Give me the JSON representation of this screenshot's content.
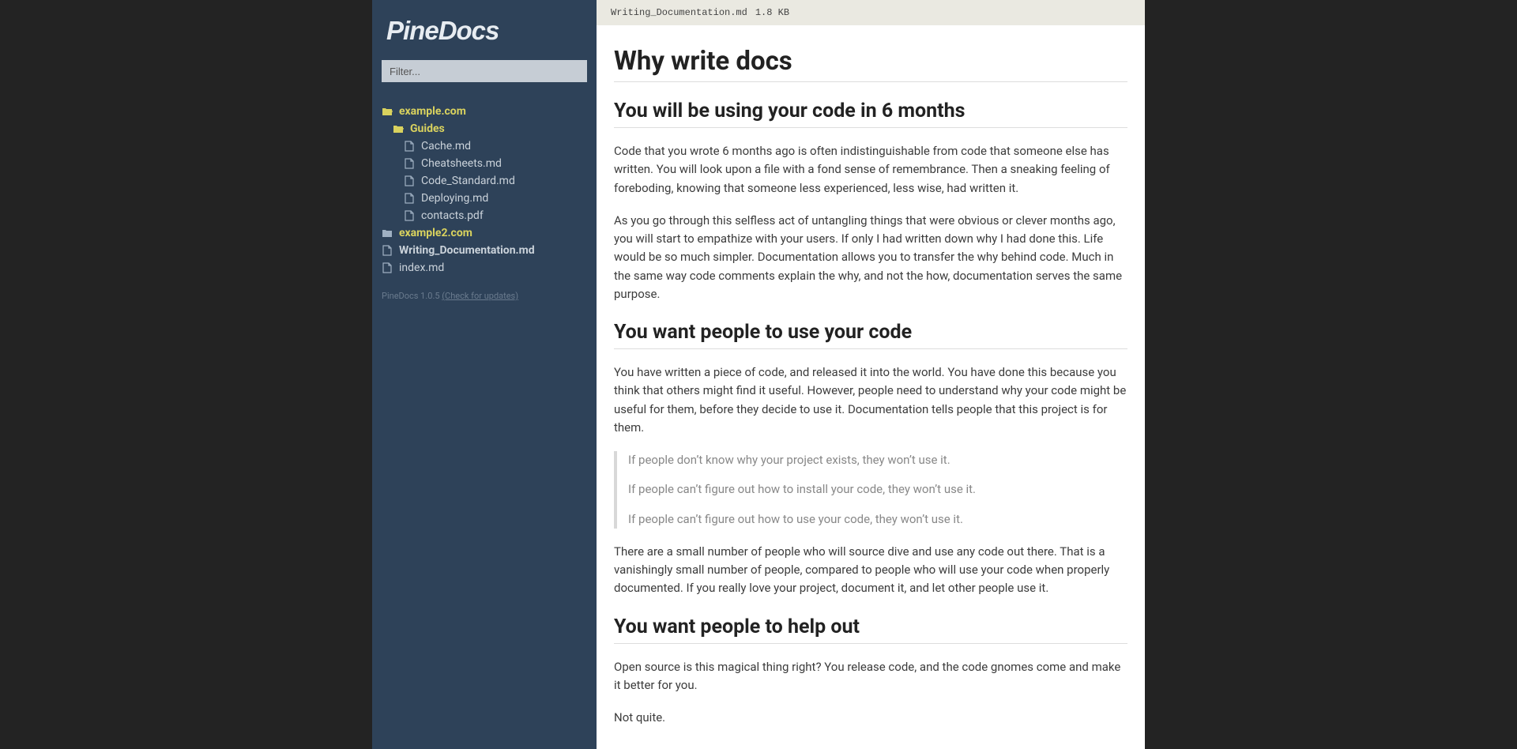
{
  "app": {
    "title": "PineDocs"
  },
  "search": {
    "placeholder": "Filter..."
  },
  "tree": [
    {
      "type": "folder-open",
      "label": "example.com",
      "indent": 1,
      "active": false
    },
    {
      "type": "folder-open",
      "label": "Guides",
      "indent": 2,
      "active": false
    },
    {
      "type": "file",
      "label": "Cache.md",
      "indent": 3,
      "active": false
    },
    {
      "type": "file",
      "label": "Cheatsheets.md",
      "indent": 3,
      "active": false
    },
    {
      "type": "file",
      "label": "Code_Standard.md",
      "indent": 3,
      "active": false
    },
    {
      "type": "file",
      "label": "Deploying.md",
      "indent": 3,
      "active": false
    },
    {
      "type": "file",
      "label": "contacts.pdf",
      "indent": 3,
      "active": false
    },
    {
      "type": "folder",
      "label": "example2.com",
      "indent": 1,
      "active": false
    },
    {
      "type": "file",
      "label": "Writing_Documentation.md",
      "indent": 1,
      "active": true
    },
    {
      "type": "file",
      "label": "index.md",
      "indent": 1,
      "active": false
    }
  ],
  "footer": {
    "version": "PineDocs 1.0.5 ",
    "link": "(Check for updates)"
  },
  "header": {
    "filename": "Writing_Documentation.md",
    "size": "1.8 KB"
  },
  "doc": {
    "h1": "Why write docs",
    "h2a": "You will be using your code in 6 months",
    "p1": "Code that you wrote 6 months ago is often indistinguishable from code that someone else has written. You will look upon a file with a fond sense of remembrance. Then a sneaking feeling of foreboding, knowing that someone less experienced, less wise, had written it.",
    "p2": "As you go through this selfless act of untangling things that were obvious or clever months ago, you will start to empathize with your users. If only I had written down why I had done this. Life would be so much simpler. Documentation allows you to transfer the why behind code. Much in the same way code comments explain the why, and not the how, documentation serves the same purpose.",
    "h2b": "You want people to use your code",
    "p3": "You have written a piece of code, and released it into the world. You have done this because you think that others might find it useful. However, people need to understand why your code might be useful for them, before they decide to use it. Documentation tells people that this project is for them.",
    "q1": "If people don’t know why your project exists, they won’t use it.",
    "q2": "If people can’t figure out how to install your code, they won’t use it.",
    "q3": "If people can’t figure out how to use your code, they won’t use it.",
    "p4": "There are a small number of people who will source dive and use any code out there. That is a vanishingly small number of people, compared to people who will use your code when properly documented. If you really love your project, document it, and let other people use it.",
    "h2c": "You want people to help out",
    "p5": "Open source is this magical thing right? You release code, and the code gnomes come and make it better for you.",
    "p6": "Not quite."
  }
}
